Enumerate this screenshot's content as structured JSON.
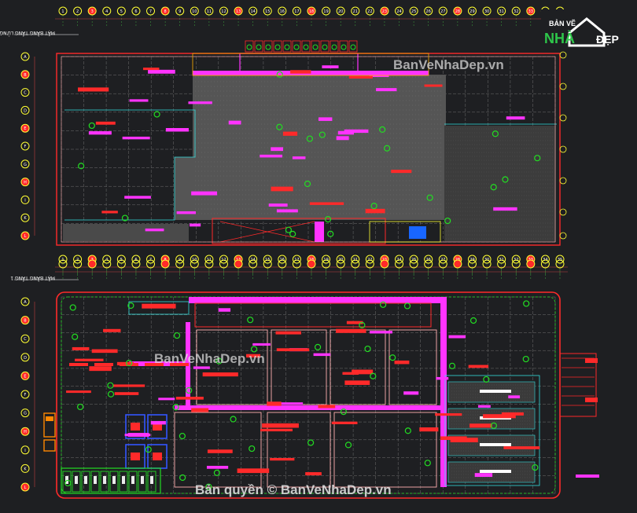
{
  "drawing": {
    "top_plan_title": "MẶT BẰNG TẦNG LỬNG",
    "bottom_plan_title": "MẶT BẰNG TẦNG 1",
    "top_axis_labels": [
      "1",
      "2",
      "3",
      "4",
      "5",
      "6",
      "7",
      "8",
      "9",
      "10",
      "11",
      "12",
      "13",
      "14",
      "15",
      "16",
      "17",
      "18",
      "19",
      "20",
      "21",
      "22",
      "23",
      "24",
      "25",
      "26",
      "27",
      "28",
      "29",
      "30",
      "31",
      "32",
      "33",
      "34",
      "35"
    ],
    "left_axis_labels": [
      "A",
      "B",
      "C",
      "D",
      "E",
      "F",
      "G",
      "H",
      "I",
      "K",
      "L"
    ],
    "colors": {
      "background": "#1e1f22",
      "wall": "#ff2a2a",
      "grid": "#9a9a9a",
      "magenta": "#ff33ff",
      "green": "#22dd22",
      "yellow": "#ffff33",
      "cyan": "#33dddd",
      "blue": "#3355ff"
    }
  },
  "logo": {
    "line1": "BẢN VẼ",
    "word_left": "NHÀ",
    "word_right": "ĐẸP"
  },
  "watermarks": {
    "top": "BanVeNhaDep.vn",
    "middle": "BanVeNhaDep.vn",
    "bottom": "Bản quyền © BanVeNhaDep.vn"
  }
}
